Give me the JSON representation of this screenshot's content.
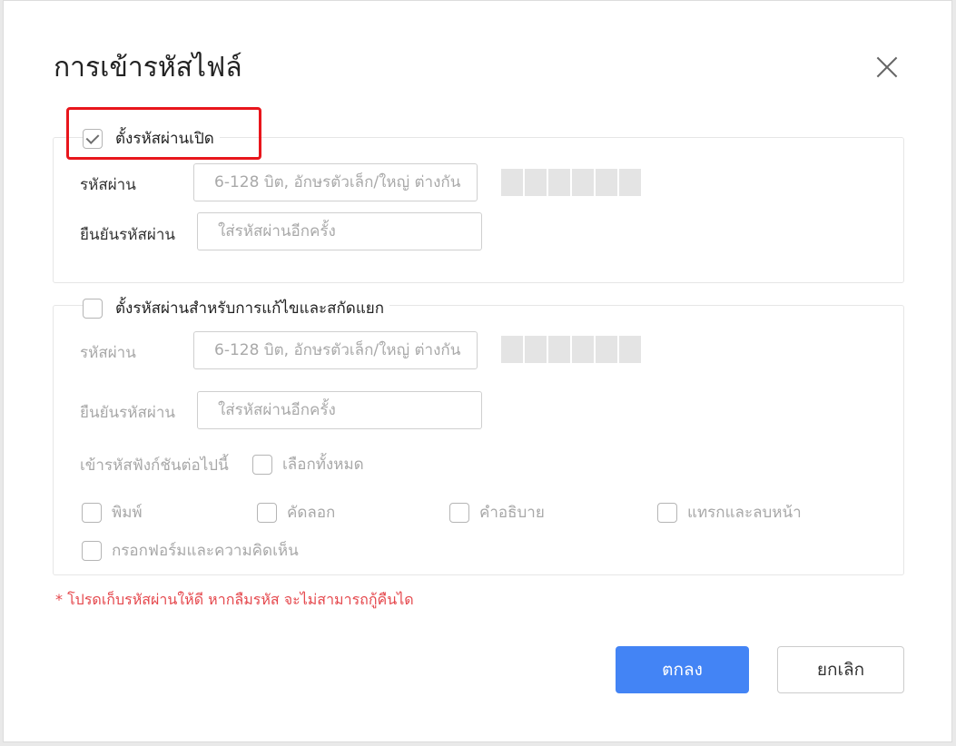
{
  "dialog": {
    "title": "การเข้ารหัสไฟล์",
    "close_icon": "close-icon"
  },
  "open_password": {
    "checkbox_label": "ตั้งรหัสผ่านเปิด",
    "checked": true,
    "password_label": "รหัสผ่าน",
    "password_placeholder": "6-128 บิต, อักษรตัวเล็ก/ใหญ่ ต่างกัน",
    "confirm_label": "ยืนยันรหัสผ่าน",
    "confirm_placeholder": "ใส่รหัสผ่านอีกครั้ง"
  },
  "edit_password": {
    "checkbox_label": "ตั้งรหัสผ่านสำหรับการแก้ไขและสกัดแยก",
    "checked": false,
    "password_label": "รหัสผ่าน",
    "password_placeholder": "6-128 บิต, อักษรตัวเล็ก/ใหญ่ ต่างกัน",
    "confirm_label": "ยืนยันรหัสผ่าน",
    "confirm_placeholder": "ใส่รหัสผ่านอีกครั้ง",
    "functions_label": "เข้ารหัสฟังก์ชันต่อไปนี้",
    "select_all_label": "เลือกทั้งหมด",
    "options": [
      {
        "label": "พิมพ์",
        "checked": false
      },
      {
        "label": "คัดลอก",
        "checked": false
      },
      {
        "label": "คำอธิบาย",
        "checked": false
      },
      {
        "label": "แทรกและลบหน้า",
        "checked": false
      },
      {
        "label": "กรอกฟอร์มและความคิดเห็น",
        "checked": false
      }
    ]
  },
  "warning": "*  โปรดเก็บรหัสผ่านให้ดี หากลืมรหัส จะไม่สามารถกู้คืนได",
  "buttons": {
    "ok": "ตกลง",
    "cancel": "ยกเลิก"
  },
  "colors": {
    "primary": "#4384f5",
    "warning": "#e5484d",
    "highlight": "#e8161c"
  }
}
